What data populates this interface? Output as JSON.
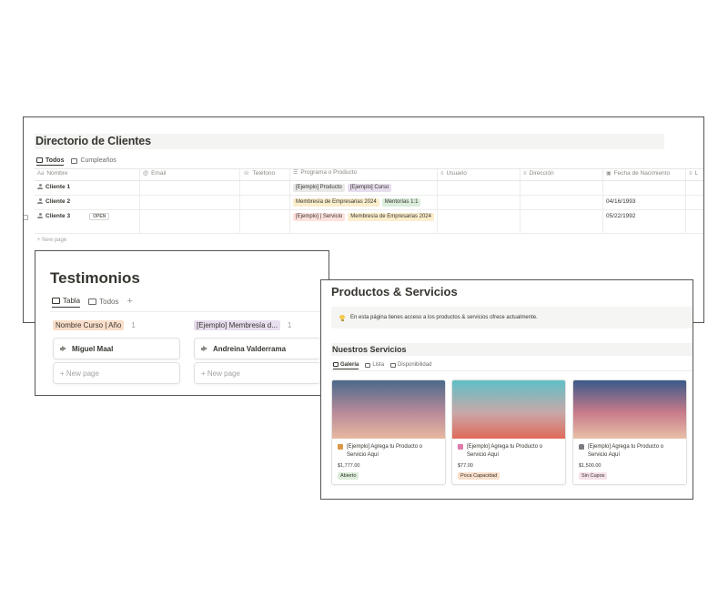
{
  "directorio": {
    "title": "Directorio de Clientes",
    "views": [
      {
        "label": "Todos",
        "icon": "table-icon",
        "active": true
      },
      {
        "label": "Cumpleaños",
        "icon": "calendar-icon",
        "active": false
      }
    ],
    "columns": [
      {
        "label": "Nombre",
        "icon_text": "Aa"
      },
      {
        "label": "Email",
        "icon_text": "@"
      },
      {
        "label": "Teléfono",
        "icon_text": "☏"
      },
      {
        "label": "Programa o Producto",
        "icon_text": "☰"
      },
      {
        "label": "Usuario",
        "icon_text": "≡"
      },
      {
        "label": "Dirección",
        "icon_text": "≡"
      },
      {
        "label": "Fecha de Nacimiento",
        "icon_text": "▣"
      },
      {
        "label": "L",
        "icon_text": "≡"
      }
    ],
    "rows": [
      {
        "name": "Cliente 1",
        "tags": [
          {
            "text": "[Ejemplo] Producto",
            "color": "gray"
          },
          {
            "text": "[Ejemplo] Curso",
            "color": "purple"
          }
        ],
        "fecha": ""
      },
      {
        "name": "Cliente 2",
        "tags": [
          {
            "text": "Membresía de Empresarias 2024",
            "color": "yellow"
          },
          {
            "text": "Mentorías 1:1",
            "color": "green"
          }
        ],
        "fecha": "04/16/1993"
      },
      {
        "name": "Cliente 3",
        "open_label": "OPEN",
        "tags": [
          {
            "text": "[Ejemplo] | Servicio",
            "color": "red"
          },
          {
            "text": "Membresía de Empresarias 2024",
            "color": "yellow"
          }
        ],
        "fecha": "05/22/1992"
      }
    ],
    "new_page": "+ New page"
  },
  "testimonios": {
    "title": "Testimonios",
    "views": [
      {
        "label": "Tabla",
        "active": true
      },
      {
        "label": "Todos",
        "active": false
      }
    ],
    "add_view": "+",
    "groups": [
      {
        "label": "Nombre Curso | Año",
        "count": "1",
        "color": "orange",
        "card": "Miguel Maal"
      },
      {
        "label": "[Ejemplo] Membresía d...",
        "count": "1",
        "color": "purple",
        "card": "Andreina Valderrama"
      }
    ],
    "new_page": "+ New page"
  },
  "productos": {
    "title": "Productos & Servicios",
    "callout": "En esta página tienes acceso a los productos & servicios ofrece actualmente.",
    "subtitle": "Nuestros Servicios",
    "views": [
      {
        "label": "Galeria",
        "active": true
      },
      {
        "label": "Lista",
        "active": false
      },
      {
        "label": "Disponibilidad",
        "active": false
      }
    ],
    "cards": [
      {
        "title": "[Ejemplo] Agrega tu Producto o Servicio Aquí",
        "price": "$1,777.00",
        "badge": "Abierto",
        "badge_color": "#dbeddb"
      },
      {
        "title": "[Ejemplo] Agrega tu Producto o Servicio Aquí",
        "price": "$77.00",
        "badge": "Poca Capacidad",
        "badge_color": "#fadec9"
      },
      {
        "title": "[Ejemplo] Agrega tu Producto o Servicio Aquí",
        "price": "$1,500.00",
        "badge": "Sin Cupos",
        "badge_color": "#f5e0e9"
      }
    ]
  }
}
